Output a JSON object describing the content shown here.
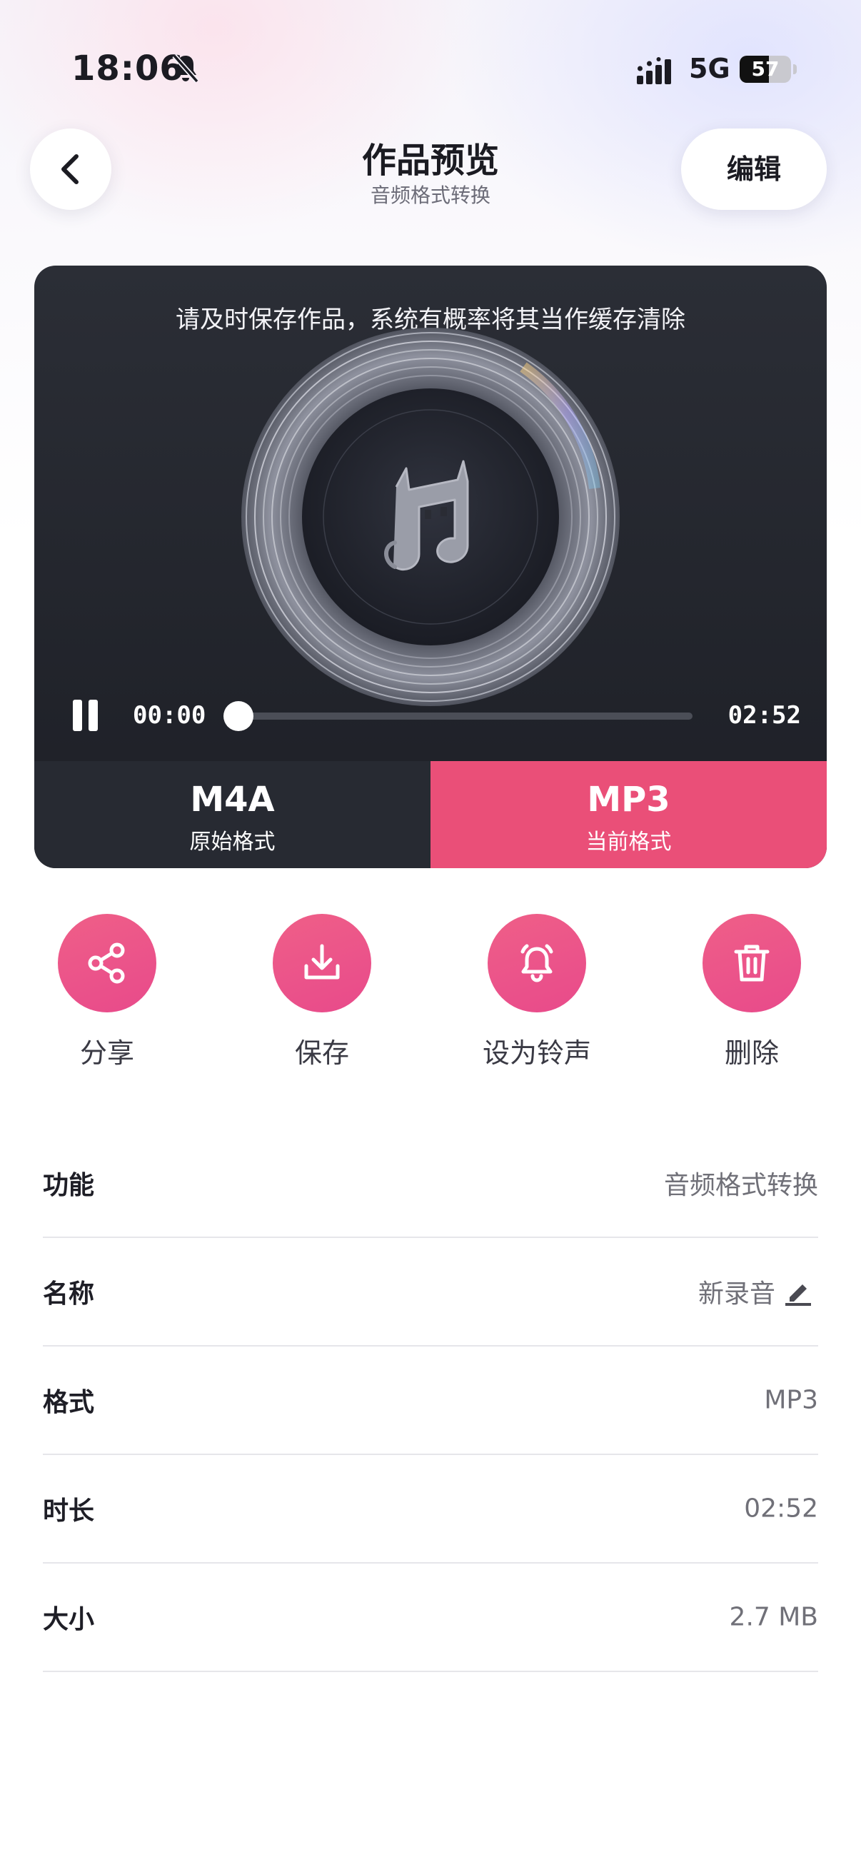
{
  "status": {
    "time": "18:06",
    "network": "5G",
    "battery": "57",
    "battery_level": 0.57
  },
  "nav": {
    "title": "作品预览",
    "subtitle": "音频格式转换",
    "edit_label": "编辑"
  },
  "player": {
    "notice": "请及时保存作品，系统有概率将其当作缓存清除",
    "current_time": "00:00",
    "total_time": "02:52",
    "progress": 0.0
  },
  "formats": {
    "original": {
      "name": "M4A",
      "label": "原始格式"
    },
    "current": {
      "name": "MP3",
      "label": "当前格式"
    }
  },
  "actions": [
    {
      "label": "分享",
      "icon": "share-icon"
    },
    {
      "label": "保存",
      "icon": "download-icon"
    },
    {
      "label": "设为铃声",
      "icon": "bell-icon"
    },
    {
      "label": "删除",
      "icon": "trash-icon"
    }
  ],
  "info": [
    {
      "label": "功能",
      "value": "音频格式转换"
    },
    {
      "label": "名称",
      "value": "新录音"
    },
    {
      "label": "格式",
      "value": "MP3"
    },
    {
      "label": "时长",
      "value": "02:52"
    },
    {
      "label": "大小",
      "value": "2.7 MB"
    }
  ],
  "colors": {
    "accent": "#ea4f78",
    "card_dark": "#272a32"
  }
}
